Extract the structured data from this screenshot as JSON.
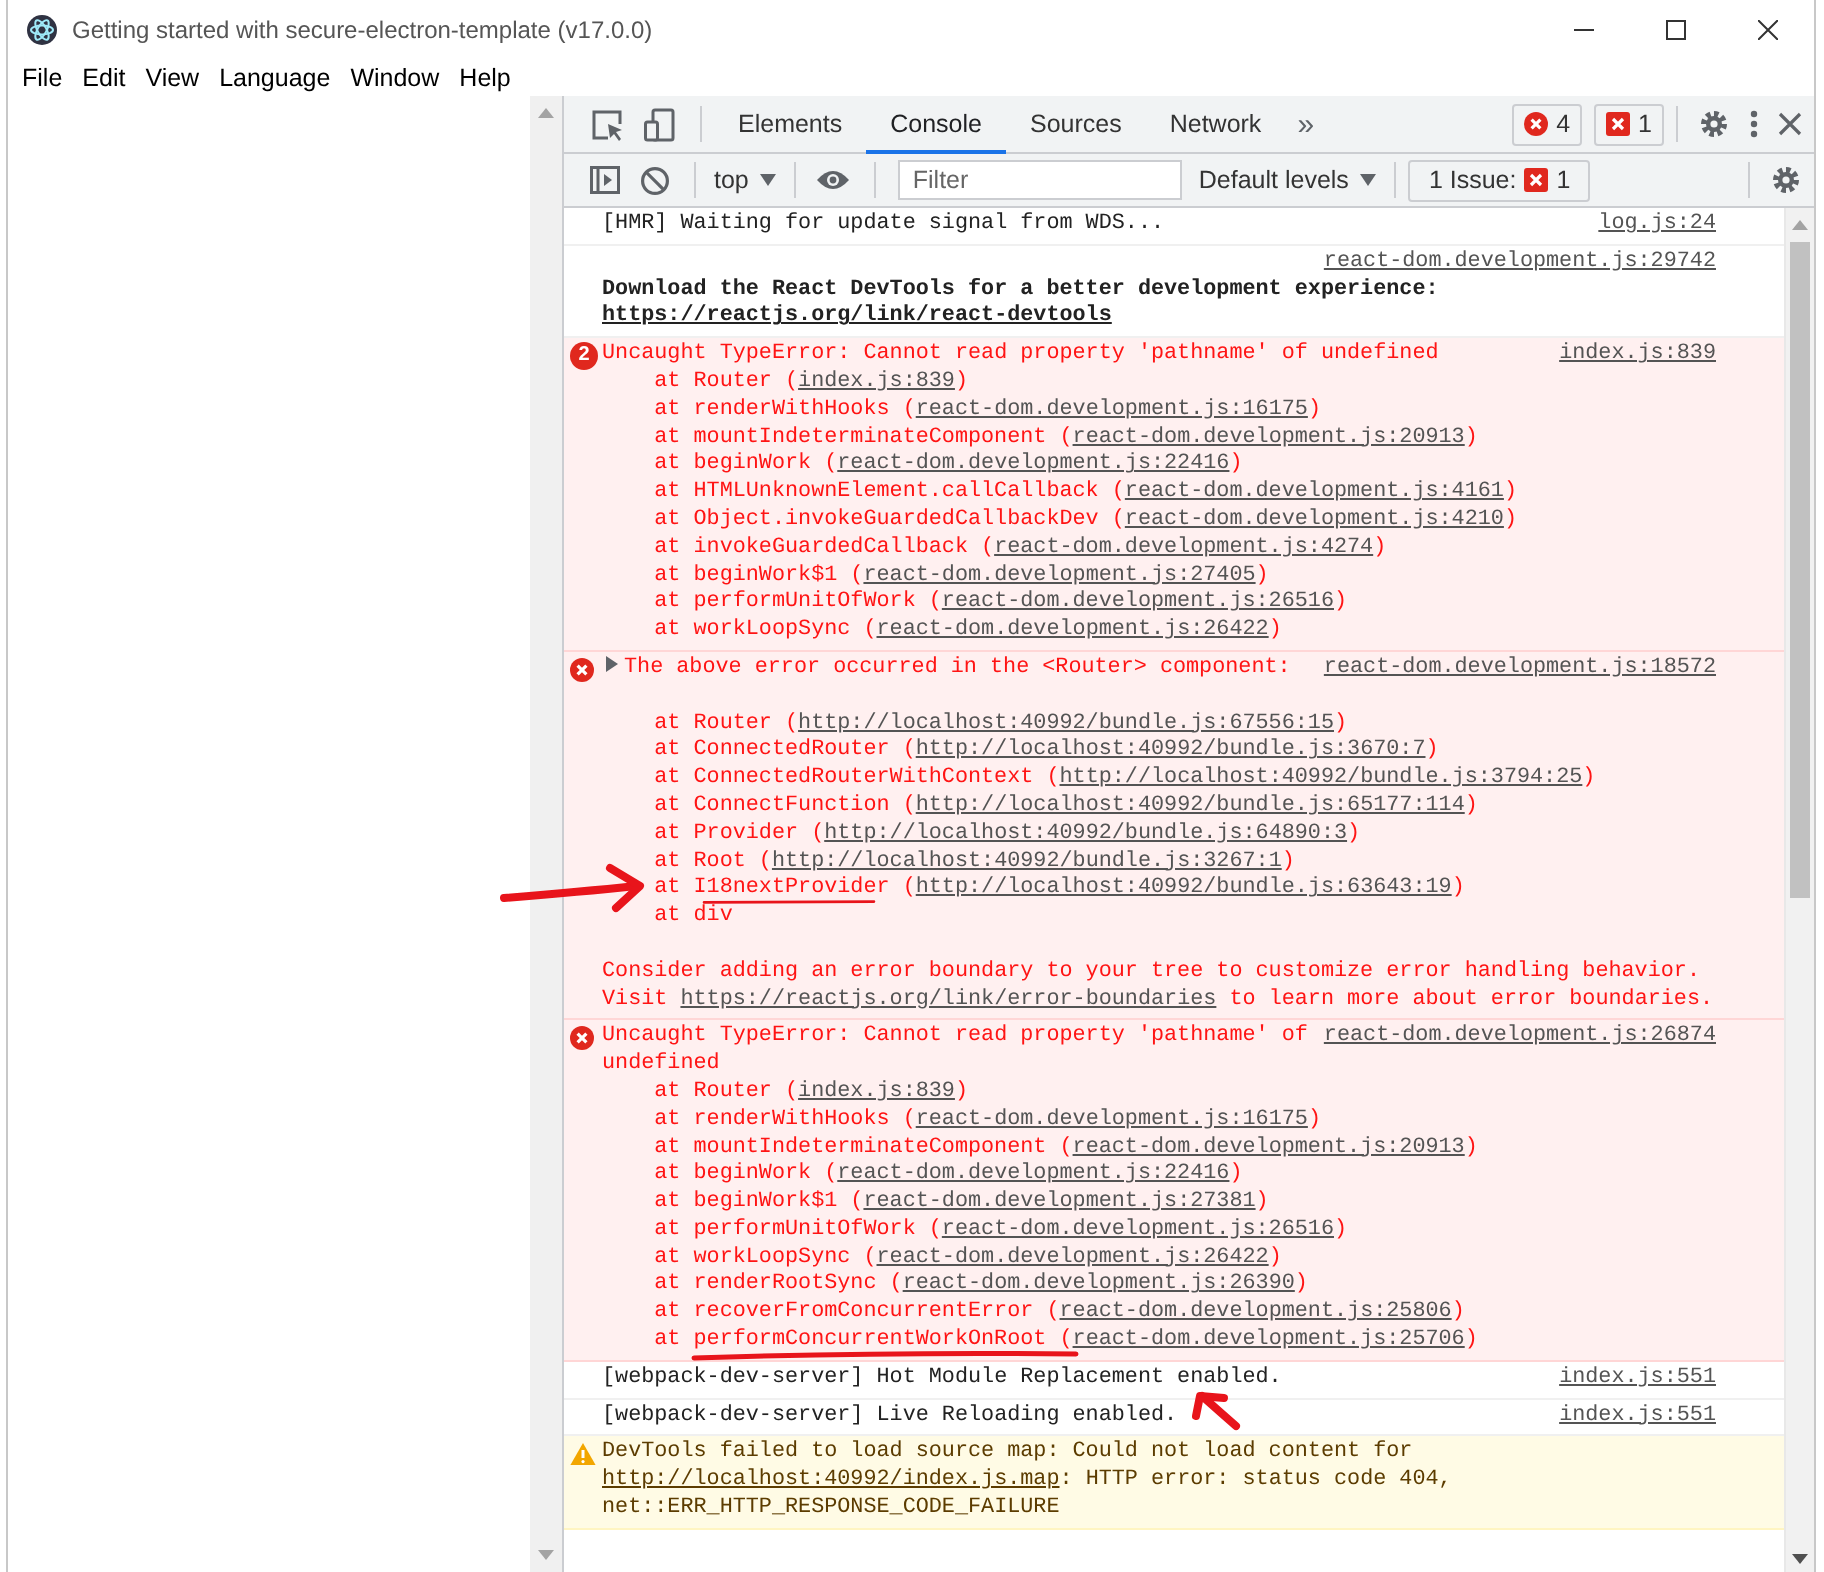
{
  "window": {
    "title": "Getting started with secure-electron-template (v17.0.0)"
  },
  "menu": [
    {
      "label": "File"
    },
    {
      "label": "Edit"
    },
    {
      "label": "View"
    },
    {
      "label": "Language"
    },
    {
      "label": "Window"
    },
    {
      "label": "Help"
    }
  ],
  "devtools": {
    "tabs": [
      {
        "label": "Elements",
        "selected": false
      },
      {
        "label": "Console",
        "selected": true
      },
      {
        "label": "Sources",
        "selected": false
      },
      {
        "label": "Network",
        "selected": false
      }
    ],
    "more_tabs": "»",
    "error_count": "4",
    "issue_count": "1",
    "context": "top",
    "filter": {
      "placeholder": "Filter"
    },
    "levels": "Default levels",
    "issues_button": {
      "label": "1 Issue:",
      "count": "1"
    }
  },
  "console": [
    {
      "kind": "log",
      "bold": false,
      "source": "log.js:24",
      "lines": [
        {
          "kind": "text",
          "parts": [
            {
              "text": "[HMR] Waiting for update signal from WDS..."
            }
          ]
        }
      ]
    },
    {
      "kind": "log",
      "bold": true,
      "source": "react-dom.development.js:29742",
      "lines": [
        {
          "kind": "text",
          "parts": [
            {
              "text": "Download the React DevTools for a better development experience: "
            },
            {
              "text": "https://reactjs.org/link/react-devtools",
              "link": true
            }
          ]
        }
      ]
    },
    {
      "kind": "error",
      "bold": false,
      "count": "2",
      "source": "index.js:839",
      "lines": [
        {
          "kind": "text",
          "parts": [
            {
              "text": "Uncaught TypeError: Cannot read property 'pathname' of undefined"
            }
          ]
        },
        {
          "kind": "frame",
          "parts": [
            {
              "text": "at Router ("
            },
            {
              "text": "index.js:839",
              "link": true
            },
            {
              "text": ")"
            }
          ]
        },
        {
          "kind": "frame",
          "parts": [
            {
              "text": "at renderWithHooks ("
            },
            {
              "text": "react-dom.development.js:16175",
              "link": true
            },
            {
              "text": ")"
            }
          ]
        },
        {
          "kind": "frame",
          "parts": [
            {
              "text": "at mountIndeterminateComponent ("
            },
            {
              "text": "react-dom.development.js:20913",
              "link": true
            },
            {
              "text": ")"
            }
          ]
        },
        {
          "kind": "frame",
          "parts": [
            {
              "text": "at beginWork ("
            },
            {
              "text": "react-dom.development.js:22416",
              "link": true
            },
            {
              "text": ")"
            }
          ]
        },
        {
          "kind": "frame",
          "parts": [
            {
              "text": "at HTMLUnknownElement.callCallback ("
            },
            {
              "text": "react-dom.development.js:4161",
              "link": true
            },
            {
              "text": ")"
            }
          ]
        },
        {
          "kind": "frame",
          "parts": [
            {
              "text": "at Object.invokeGuardedCallbackDev ("
            },
            {
              "text": "react-dom.development.js:4210",
              "link": true
            },
            {
              "text": ")"
            }
          ]
        },
        {
          "kind": "frame",
          "parts": [
            {
              "text": "at invokeGuardedCallback ("
            },
            {
              "text": "react-dom.development.js:4274",
              "link": true
            },
            {
              "text": ")"
            }
          ]
        },
        {
          "kind": "frame",
          "parts": [
            {
              "text": "at beginWork$1 ("
            },
            {
              "text": "react-dom.development.js:27405",
              "link": true
            },
            {
              "text": ")"
            }
          ]
        },
        {
          "kind": "frame",
          "parts": [
            {
              "text": "at performUnitOfWork ("
            },
            {
              "text": "react-dom.development.js:26516",
              "link": true
            },
            {
              "text": ")"
            }
          ]
        },
        {
          "kind": "frame",
          "parts": [
            {
              "text": "at workLoopSync ("
            },
            {
              "text": "react-dom.development.js:26422",
              "link": true
            },
            {
              "text": ")"
            }
          ]
        }
      ]
    },
    {
      "kind": "error",
      "bold": false,
      "expanded": false,
      "source": "react-dom.development.js:18572",
      "lines": [
        {
          "kind": "text",
          "parts": [
            {
              "text": "The above error occurred in the <Router> component:"
            }
          ]
        },
        {
          "kind": "blank"
        },
        {
          "kind": "frame",
          "parts": [
            {
              "text": "at Router ("
            },
            {
              "text": "http://localhost:40992/bundle.js:67556:15",
              "link": true
            },
            {
              "text": ")"
            }
          ]
        },
        {
          "kind": "frame",
          "parts": [
            {
              "text": "at ConnectedRouter ("
            },
            {
              "text": "http://localhost:40992/bundle.js:3670:7",
              "link": true
            },
            {
              "text": ")"
            }
          ]
        },
        {
          "kind": "frame",
          "parts": [
            {
              "text": "at ConnectedRouterWithContext ("
            },
            {
              "text": "http://localhost:40992/bundle.js:3794:25",
              "link": true
            },
            {
              "text": ")"
            }
          ]
        },
        {
          "kind": "frame",
          "parts": [
            {
              "text": "at ConnectFunction ("
            },
            {
              "text": "http://localhost:40992/bundle.js:65177:114",
              "link": true
            },
            {
              "text": ")"
            }
          ]
        },
        {
          "kind": "frame",
          "parts": [
            {
              "text": "at Provider ("
            },
            {
              "text": "http://localhost:40992/bundle.js:64890:3",
              "link": true
            },
            {
              "text": ")"
            }
          ]
        },
        {
          "kind": "frame",
          "parts": [
            {
              "text": "at Root ("
            },
            {
              "text": "http://localhost:40992/bundle.js:3267:1",
              "link": true
            },
            {
              "text": ")"
            }
          ]
        },
        {
          "kind": "frame",
          "parts": [
            {
              "text": "at I18nextProvider ("
            },
            {
              "text": "http://localhost:40992/bundle.js:63643:19",
              "link": true
            },
            {
              "text": ")"
            }
          ]
        },
        {
          "kind": "frame",
          "parts": [
            {
              "text": "at div"
            }
          ]
        },
        {
          "kind": "blank"
        },
        {
          "kind": "text",
          "parts": [
            {
              "text": "Consider adding an error boundary to your tree to customize error handling behavior."
            }
          ]
        },
        {
          "kind": "text",
          "parts": [
            {
              "text": "Visit "
            },
            {
              "text": "https://reactjs.org/link/error-boundaries",
              "link": true
            },
            {
              "text": " to learn more about error boundaries."
            }
          ]
        }
      ]
    },
    {
      "kind": "error",
      "bold": false,
      "source": "react-dom.development.js:26874",
      "lines": [
        {
          "kind": "text",
          "parts": [
            {
              "text": "Uncaught TypeError: Cannot read property 'pathname' of undefined"
            }
          ]
        },
        {
          "kind": "frame",
          "parts": [
            {
              "text": "at Router ("
            },
            {
              "text": "index.js:839",
              "link": true
            },
            {
              "text": ")"
            }
          ]
        },
        {
          "kind": "frame",
          "parts": [
            {
              "text": "at renderWithHooks ("
            },
            {
              "text": "react-dom.development.js:16175",
              "link": true
            },
            {
              "text": ")"
            }
          ]
        },
        {
          "kind": "frame",
          "parts": [
            {
              "text": "at mountIndeterminateComponent ("
            },
            {
              "text": "react-dom.development.js:20913",
              "link": true
            },
            {
              "text": ")"
            }
          ]
        },
        {
          "kind": "frame",
          "parts": [
            {
              "text": "at beginWork ("
            },
            {
              "text": "react-dom.development.js:22416",
              "link": true
            },
            {
              "text": ")"
            }
          ]
        },
        {
          "kind": "frame",
          "parts": [
            {
              "text": "at beginWork$1 ("
            },
            {
              "text": "react-dom.development.js:27381",
              "link": true
            },
            {
              "text": ")"
            }
          ]
        },
        {
          "kind": "frame",
          "parts": [
            {
              "text": "at performUnitOfWork ("
            },
            {
              "text": "react-dom.development.js:26516",
              "link": true
            },
            {
              "text": ")"
            }
          ]
        },
        {
          "kind": "frame",
          "parts": [
            {
              "text": "at workLoopSync ("
            },
            {
              "text": "react-dom.development.js:26422",
              "link": true
            },
            {
              "text": ")"
            }
          ]
        },
        {
          "kind": "frame",
          "parts": [
            {
              "text": "at renderRootSync ("
            },
            {
              "text": "react-dom.development.js:26390",
              "link": true
            },
            {
              "text": ")"
            }
          ]
        },
        {
          "kind": "frame",
          "parts": [
            {
              "text": "at recoverFromConcurrentError ("
            },
            {
              "text": "react-dom.development.js:25806",
              "link": true
            },
            {
              "text": ")"
            }
          ]
        },
        {
          "kind": "frame",
          "parts": [
            {
              "text": "at performConcurrentWorkOnRoot ("
            },
            {
              "text": "react-dom.development.js:25706",
              "link": true
            },
            {
              "text": ")"
            }
          ]
        }
      ]
    },
    {
      "kind": "log",
      "bold": false,
      "source": "index.js:551",
      "lines": [
        {
          "kind": "text",
          "parts": [
            {
              "text": "[webpack-dev-server] Hot Module Replacement enabled."
            }
          ]
        }
      ]
    },
    {
      "kind": "log",
      "bold": false,
      "source": "index.js:551",
      "lines": [
        {
          "kind": "text",
          "parts": [
            {
              "text": "[webpack-dev-server] Live Reloading enabled."
            }
          ]
        }
      ]
    },
    {
      "kind": "warning",
      "bold": false,
      "lines": [
        {
          "kind": "text",
          "parts": [
            {
              "text": "DevTools failed to load source map: Could not load content for "
            },
            {
              "text": "http://localhost:40992/index.js.map",
              "link": true
            },
            {
              "text": ": HTTP error: status code 404, net::ERR_HTTP_RESPONSE_CODE_FAILURE"
            }
          ]
        }
      ]
    }
  ]
}
